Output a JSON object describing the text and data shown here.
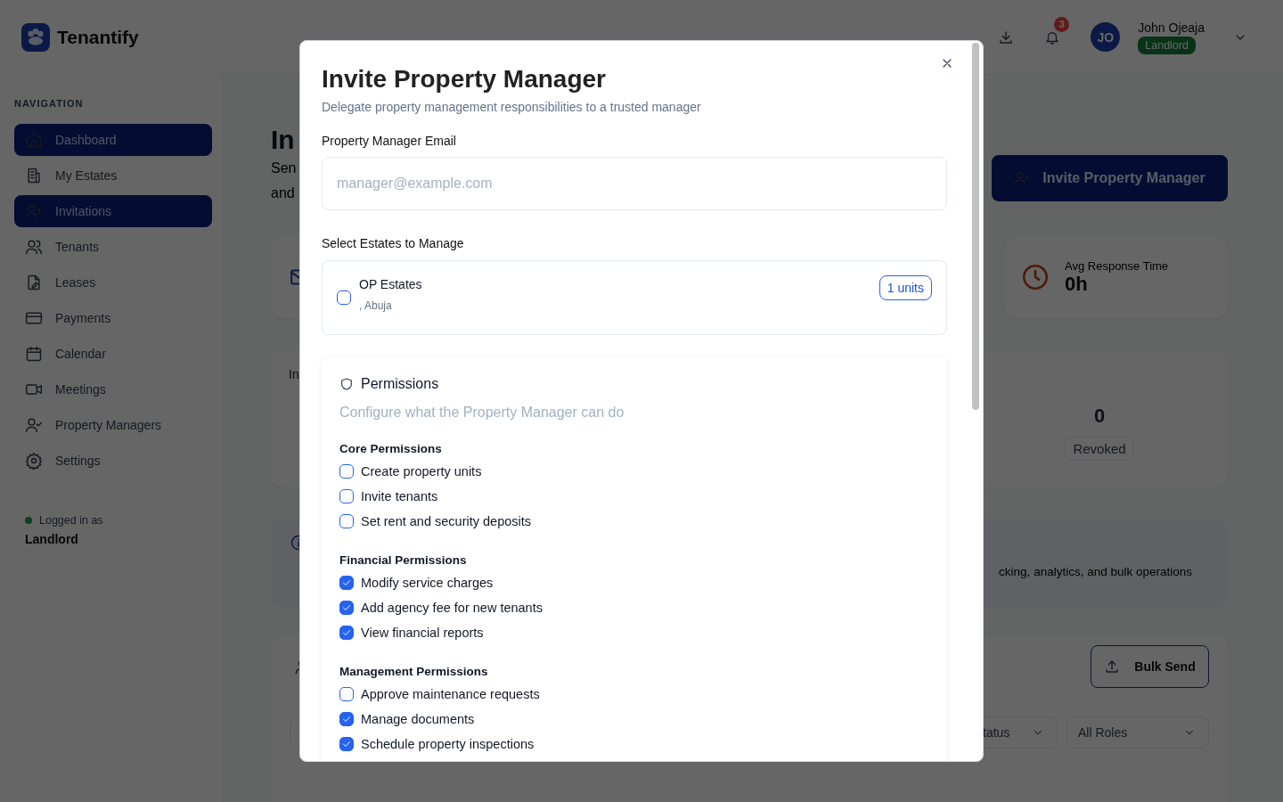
{
  "app": {
    "name": "Tenantify"
  },
  "header": {
    "notifications": "3",
    "user": {
      "initials": "JO",
      "name": "John Ojeaja",
      "role": "Landlord"
    }
  },
  "sidebar": {
    "heading": "NAVIGATION",
    "items": [
      {
        "label": "Dashboard",
        "selected": true
      },
      {
        "label": "My Estates",
        "selected": false
      },
      {
        "label": "Invitations",
        "selected": true
      },
      {
        "label": "Tenants",
        "selected": false
      },
      {
        "label": "Leases",
        "selected": false
      },
      {
        "label": "Payments",
        "selected": false
      },
      {
        "label": "Calendar",
        "selected": false
      },
      {
        "label": "Meetings",
        "selected": false
      },
      {
        "label": "Property Managers",
        "selected": false
      },
      {
        "label": "Settings",
        "selected": false
      }
    ],
    "status": {
      "label": "Logged in as",
      "role": "Landlord"
    }
  },
  "page": {
    "title": "In",
    "subtitle_lines": [
      "Sen",
      "and"
    ],
    "primary_button": "Invite Property Manager",
    "stats": [
      {
        "label": "Avg Response Time",
        "value": "0h"
      }
    ],
    "summary": {
      "title": "In",
      "value": "0",
      "label": "Revoked"
    },
    "banner": {
      "text": "cking, analytics, and bulk operations"
    },
    "list": {
      "bulk_button": "Bulk Send",
      "filters": [
        {
          "value": "tatus"
        },
        {
          "value": "All Roles"
        }
      ]
    }
  },
  "modal": {
    "title": "Invite Property Manager",
    "description": "Delegate property management responsibilities to a trusted manager",
    "email": {
      "label": "Property Manager Email",
      "placeholder": "manager@example.com"
    },
    "estates": {
      "label": "Select Estates to Manage",
      "items": [
        {
          "name": "OP Estates",
          "location": ", Abuja",
          "units": "1 units",
          "checked": false
        }
      ]
    },
    "permissions": {
      "title": "Permissions",
      "description": "Configure what the Property Manager can do",
      "groups": [
        {
          "title": "Core Permissions",
          "items": [
            {
              "label": "Create property units",
              "checked": false
            },
            {
              "label": "Invite tenants",
              "checked": false
            },
            {
              "label": "Set rent and security deposits",
              "checked": false
            }
          ]
        },
        {
          "title": "Financial Permissions",
          "items": [
            {
              "label": "Modify service charges",
              "checked": true
            },
            {
              "label": "Add agency fee for new tenants",
              "checked": true
            },
            {
              "label": "View financial reports",
              "checked": true
            }
          ]
        },
        {
          "title": "Management Permissions",
          "items": [
            {
              "label": "Approve maintenance requests",
              "checked": false
            },
            {
              "label": "Manage documents",
              "checked": true
            },
            {
              "label": "Schedule property inspections",
              "checked": true
            }
          ]
        }
      ]
    }
  }
}
